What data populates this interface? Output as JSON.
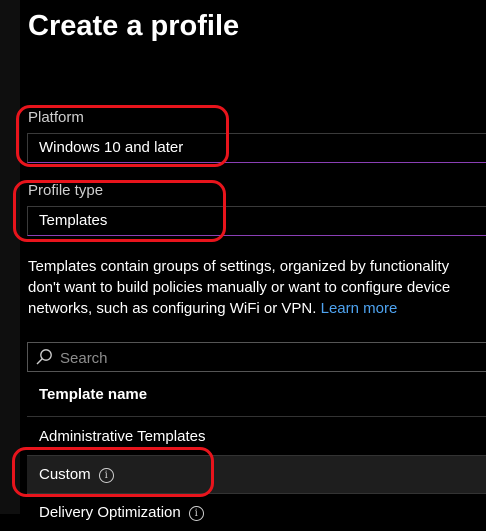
{
  "page": {
    "title": "Create a profile"
  },
  "platform": {
    "label": "Platform",
    "value": "Windows 10 and later"
  },
  "profile_type": {
    "label": "Profile type",
    "value": "Templates"
  },
  "description": {
    "line1": "Templates contain groups of settings, organized by functionality",
    "line2": "don't want to build policies manually or want to configure device",
    "line3_text": "networks, such as configuring WiFi or VPN.",
    "link": "Learn more"
  },
  "search": {
    "placeholder": "Search",
    "value": ""
  },
  "table": {
    "column_header": "Template name",
    "rows": [
      {
        "label": "Administrative Templates",
        "info": ""
      },
      {
        "label": "Custom",
        "info": "i"
      },
      {
        "label": "Delivery Optimization",
        "info": "i"
      }
    ]
  },
  "colors": {
    "background": "#000000",
    "accent_border": "#8a3fb5",
    "link": "#4ea3f0",
    "annotation": "#e8141c"
  }
}
